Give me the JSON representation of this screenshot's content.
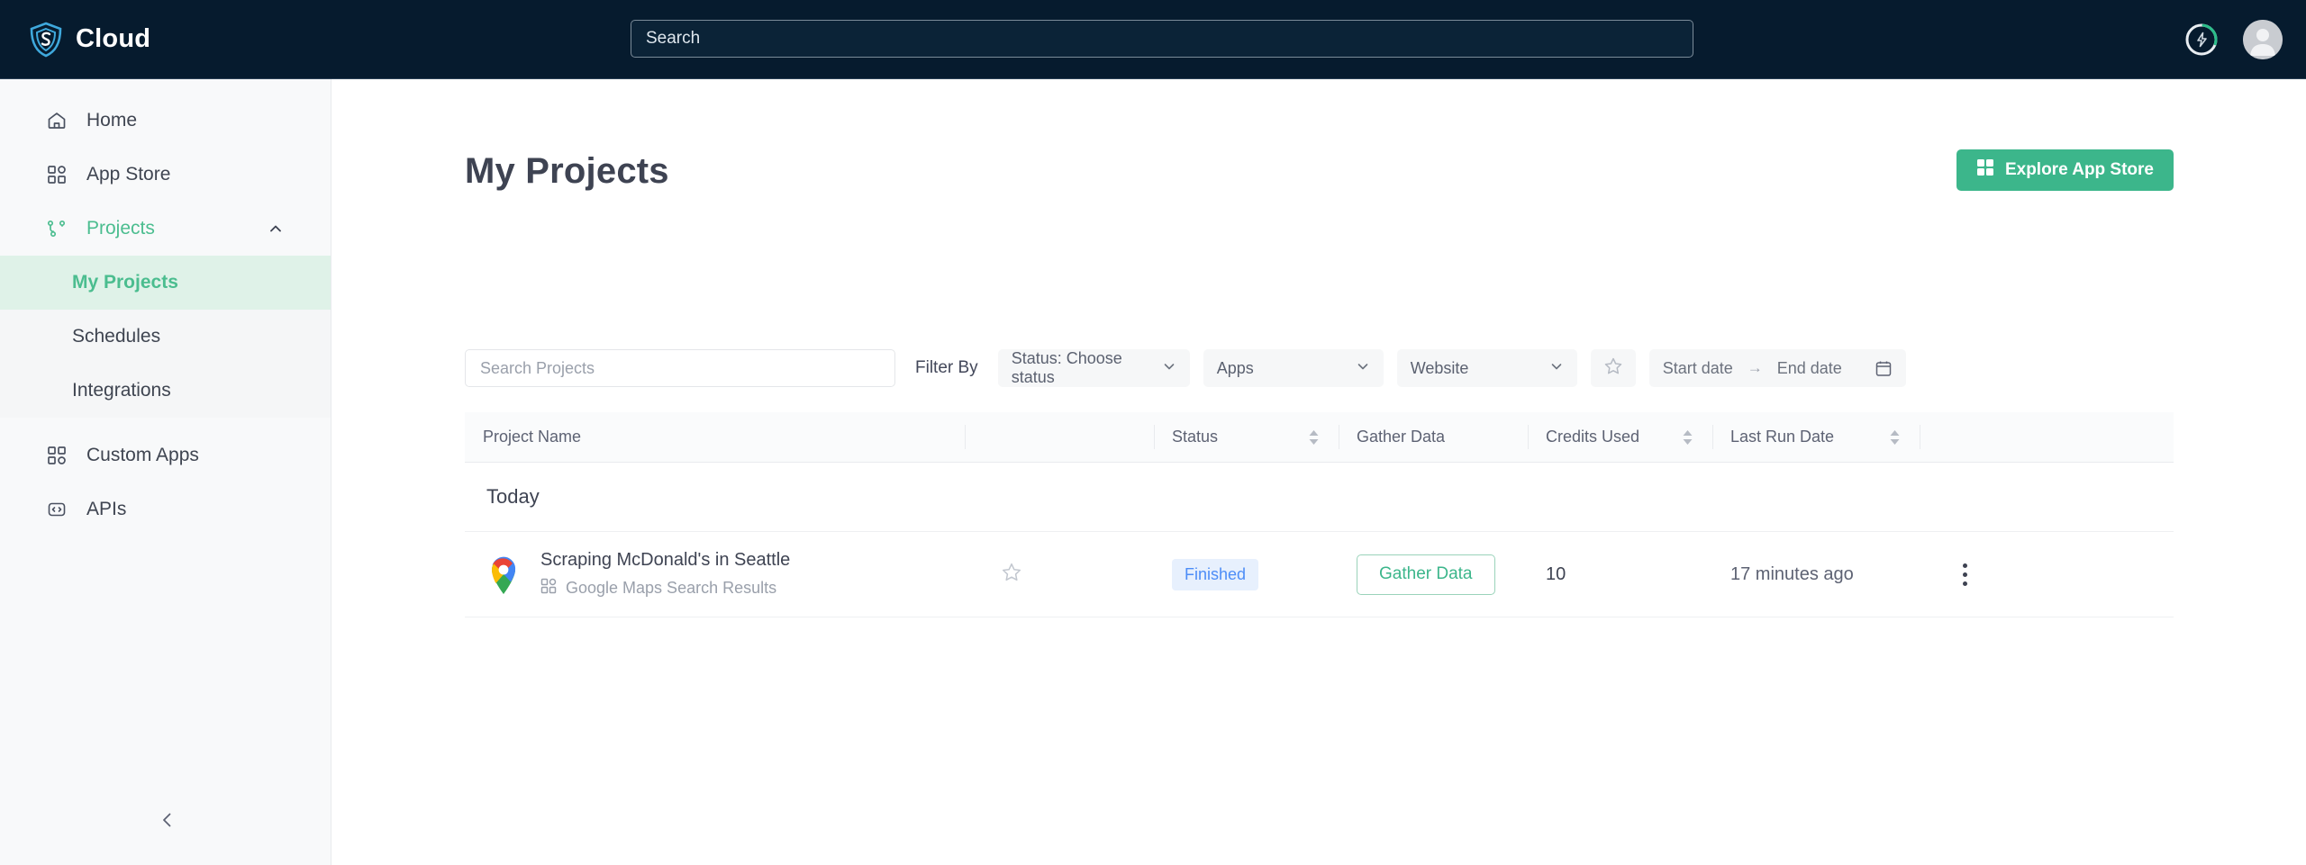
{
  "topbar": {
    "brand_name": "Cloud",
    "brand_logo_icon": "shield-s-logo",
    "search_placeholder": "Search",
    "search_value": "",
    "credits_icon": "lightning-bolt-icon",
    "avatar_icon": "user-avatar-icon"
  },
  "sidebar": {
    "items": [
      {
        "label": "Home",
        "icon": "home-icon"
      },
      {
        "label": "App Store",
        "icon": "grid-apps-icon"
      },
      {
        "label": "Projects",
        "icon": "project-branch-icon",
        "expanded": true,
        "chevron": "chevron-up-icon"
      },
      {
        "label": "Custom Apps",
        "icon": "custom-apps-grid-icon"
      },
      {
        "label": "APIs",
        "icon": "code-brackets-icon"
      }
    ],
    "sub_items": [
      {
        "label": "My Projects",
        "selected": true
      },
      {
        "label": "Schedules",
        "selected": false
      },
      {
        "label": "Integrations",
        "selected": false
      }
    ],
    "collapse_icon": "chevron-left-icon",
    "accent_color": "#4bbd8f",
    "selected_bg": "#dff2e8"
  },
  "main": {
    "page_title": "My Projects",
    "explore_button": {
      "label": "Explore App Store",
      "icon": "grid-apps-icon",
      "color": "#3cb68b"
    }
  },
  "filters": {
    "search_placeholder": "Search Projects",
    "search_value": "",
    "filter_by_label": "Filter By",
    "status_dropdown": {
      "label": "Status: Choose status",
      "chevron": "chevron-down-icon"
    },
    "apps_dropdown": {
      "label": "Apps",
      "chevron": "chevron-down-icon"
    },
    "website_dropdown": {
      "label": "Website",
      "chevron": "chevron-down-icon"
    },
    "favorite_icon": "star-outline-icon",
    "start_date_placeholder": "Start date",
    "date_separator": "→",
    "end_date_placeholder": "End date",
    "calendar_icon": "calendar-icon"
  },
  "table": {
    "columns": [
      {
        "label": "Project Name",
        "sortable": false
      },
      {
        "label": "",
        "sortable": false
      },
      {
        "label": "Status",
        "sortable": true
      },
      {
        "label": "Gather Data",
        "sortable": false
      },
      {
        "label": "Credits Used",
        "sortable": true
      },
      {
        "label": "Last Run Date",
        "sortable": true
      },
      {
        "label": "",
        "sortable": false
      }
    ],
    "groups": [
      {
        "label": "Today",
        "rows": [
          {
            "app_icon": "google-maps-pin-icon",
            "name": "Scraping McDonald's in Seattle",
            "source_icon": "grid-apps-icon",
            "source": "Google Maps Search Results",
            "favorite_icon": "star-outline-icon",
            "favorited": false,
            "status": "Finished",
            "status_color": "#4d8df7",
            "status_bg": "#e7f0fd",
            "gather_button": "Gather Data",
            "credits_used": "10",
            "last_run": "17 minutes ago",
            "menu_icon": "kebab-menu-icon"
          }
        ]
      }
    ]
  }
}
